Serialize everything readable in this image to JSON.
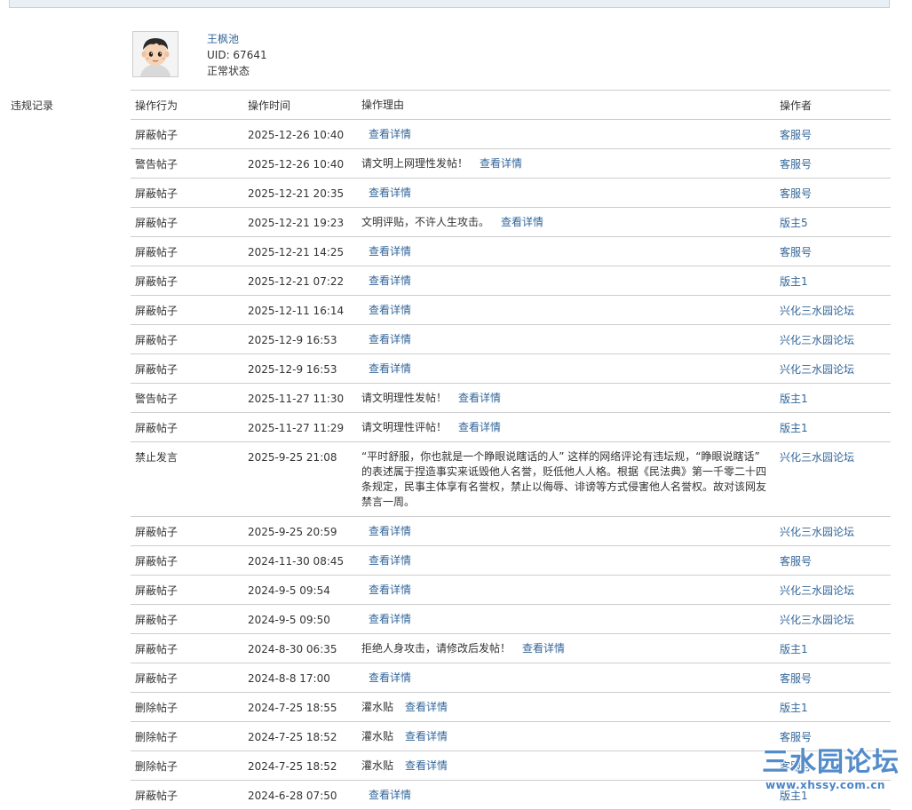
{
  "profile": {
    "username": "王枫池",
    "uid": "UID: 67641",
    "status": "正常状态"
  },
  "section_label": "违规记录",
  "table": {
    "headers": {
      "action": "操作行为",
      "time": "操作时间",
      "reason": "操作理由",
      "operator": "操作者"
    },
    "detail_label": "查看详情",
    "rows": [
      {
        "action": "屏蔽帖子",
        "time": "2025-12-26 10:40",
        "reason": "",
        "operator": "客服号"
      },
      {
        "action": "警告帖子",
        "time": "2025-12-26 10:40",
        "reason": "请文明上网理性发帖！",
        "operator": "客服号"
      },
      {
        "action": "屏蔽帖子",
        "time": "2025-12-21 20:35",
        "reason": "",
        "operator": "客服号"
      },
      {
        "action": "屏蔽帖子",
        "time": "2025-12-21 19:23",
        "reason": "文明评贴，不许人生攻击。",
        "operator": "版主5"
      },
      {
        "action": "屏蔽帖子",
        "time": "2025-12-21 14:25",
        "reason": "",
        "operator": "客服号"
      },
      {
        "action": "屏蔽帖子",
        "time": "2025-12-21 07:22",
        "reason": "",
        "operator": "版主1"
      },
      {
        "action": "屏蔽帖子",
        "time": "2025-12-11 16:14",
        "reason": "",
        "operator": "兴化三水园论坛"
      },
      {
        "action": "屏蔽帖子",
        "time": "2025-12-9 16:53",
        "reason": "",
        "operator": "兴化三水园论坛"
      },
      {
        "action": "屏蔽帖子",
        "time": "2025-12-9 16:53",
        "reason": "",
        "operator": "兴化三水园论坛"
      },
      {
        "action": "警告帖子",
        "time": "2025-11-27 11:30",
        "reason": "请文明理性发帖！",
        "operator": "版主1"
      },
      {
        "action": "屏蔽帖子",
        "time": "2025-11-27 11:29",
        "reason": "请文明理性评帖！",
        "operator": "版主1"
      },
      {
        "action": "禁止发言",
        "time": "2025-9-25 21:08",
        "reason_long": "“平时舒服，你也就是一个睁眼说瞎话的人” 这样的网络评论有违坛规，“睁眼说瞎话” 的表述属于捏造事实来诋毁他人名誉，贬低他人人格。根据《民法典》第一千零二十四条规定，民事主体享有名誉权，禁止以侮辱、诽谤等方式侵害他人名誉权。故对该网友禁言一周。",
        "operator": "兴化三水园论坛"
      },
      {
        "action": "屏蔽帖子",
        "time": "2025-9-25 20:59",
        "reason": "",
        "operator": "兴化三水园论坛"
      },
      {
        "action": "屏蔽帖子",
        "time": "2024-11-30 08:45",
        "reason": "",
        "operator": "客服号"
      },
      {
        "action": "屏蔽帖子",
        "time": "2024-9-5 09:54",
        "reason": "",
        "operator": "兴化三水园论坛"
      },
      {
        "action": "屏蔽帖子",
        "time": "2024-9-5 09:50",
        "reason": "",
        "operator": "兴化三水园论坛"
      },
      {
        "action": "屏蔽帖子",
        "time": "2024-8-30 06:35",
        "reason": "拒绝人身攻击，请修改后发帖！",
        "operator": "版主1"
      },
      {
        "action": "屏蔽帖子",
        "time": "2024-8-8 17:00",
        "reason": "",
        "operator": "客服号"
      },
      {
        "action": "删除帖子",
        "time": "2024-7-25 18:55",
        "reason": "灌水贴",
        "operator": "版主1"
      },
      {
        "action": "删除帖子",
        "time": "2024-7-25 18:52",
        "reason": "灌水贴",
        "operator": "客服号"
      },
      {
        "action": "删除帖子",
        "time": "2024-7-25 18:52",
        "reason": "灌水贴",
        "operator": "客服号"
      },
      {
        "action": "屏蔽帖子",
        "time": "2024-6-28 07:50",
        "reason": "",
        "operator": "版主1"
      }
    ]
  },
  "watermark": {
    "title": "三水园论坛",
    "url": "www.xhssy.com.cn"
  },
  "colors": {
    "link": "#336699",
    "border": "#cdcdcd",
    "text": "#333333",
    "watermark": "#4a86c8"
  }
}
